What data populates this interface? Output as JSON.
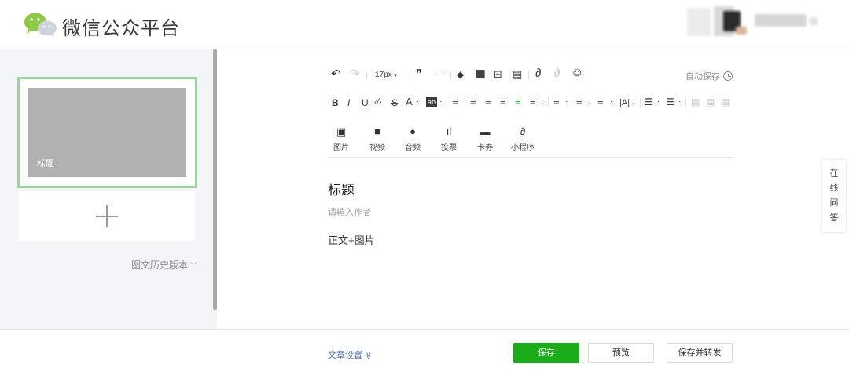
{
  "header": {
    "brand": "微信公众平台"
  },
  "sidebar": {
    "card_title": "标题",
    "history_label": "图文历史版本",
    "history_chevron": "﹀"
  },
  "toolbar": {
    "undo": "↶",
    "redo": "↷",
    "font_size": "17px",
    "font_size_caret": "▾",
    "quote": "❞",
    "hr": "—",
    "clear_format": "◆",
    "format_brush": "⬛",
    "insert_template": "⊞",
    "save_template": "▤",
    "link": "∂",
    "unlink": "∂",
    "emoji": "☺",
    "autosave_label": "自动保存",
    "bold": "B",
    "italic": "I",
    "underline": "U",
    "code": "‹/›",
    "strike": "S",
    "font_color": "A",
    "bg_color": "ab",
    "indent": "≡",
    "align_left": "≡",
    "align_center": "≡",
    "align_right": "≡",
    "align_justify": "≡",
    "para_spacing": "≡",
    "line_height_before": "≡",
    "line_height_after": "≡",
    "line_spacing": "≡",
    "letter_spacing": "|A|",
    "bullet_list": "☰",
    "ordered_list": "☰",
    "float_left": "▤",
    "float_center": "▤",
    "float_right": "▤",
    "dropdown": "·"
  },
  "media": {
    "items": [
      {
        "icon": "▣",
        "label": "图片"
      },
      {
        "icon": "■",
        "label": "视频"
      },
      {
        "icon": "●",
        "label": "音频"
      },
      {
        "icon": "ıl",
        "label": "投票"
      },
      {
        "icon": "▬",
        "label": "卡券"
      },
      {
        "icon": "∂",
        "label": "小程序"
      }
    ]
  },
  "editor": {
    "title": "标题",
    "author_placeholder": "请输入作者",
    "body": "正文+图片"
  },
  "side_tab": {
    "chars": [
      "在",
      "线",
      "问",
      "答"
    ]
  },
  "footer": {
    "settings_label": "文章设置",
    "settings_chevron": "≫",
    "save": "保存",
    "preview": "预览",
    "save_and_forward": "保存并转发"
  },
  "colors": {
    "brand_green": "#1aad19",
    "card_border": "#9bd39b",
    "link_blue": "#4a6ea8"
  }
}
